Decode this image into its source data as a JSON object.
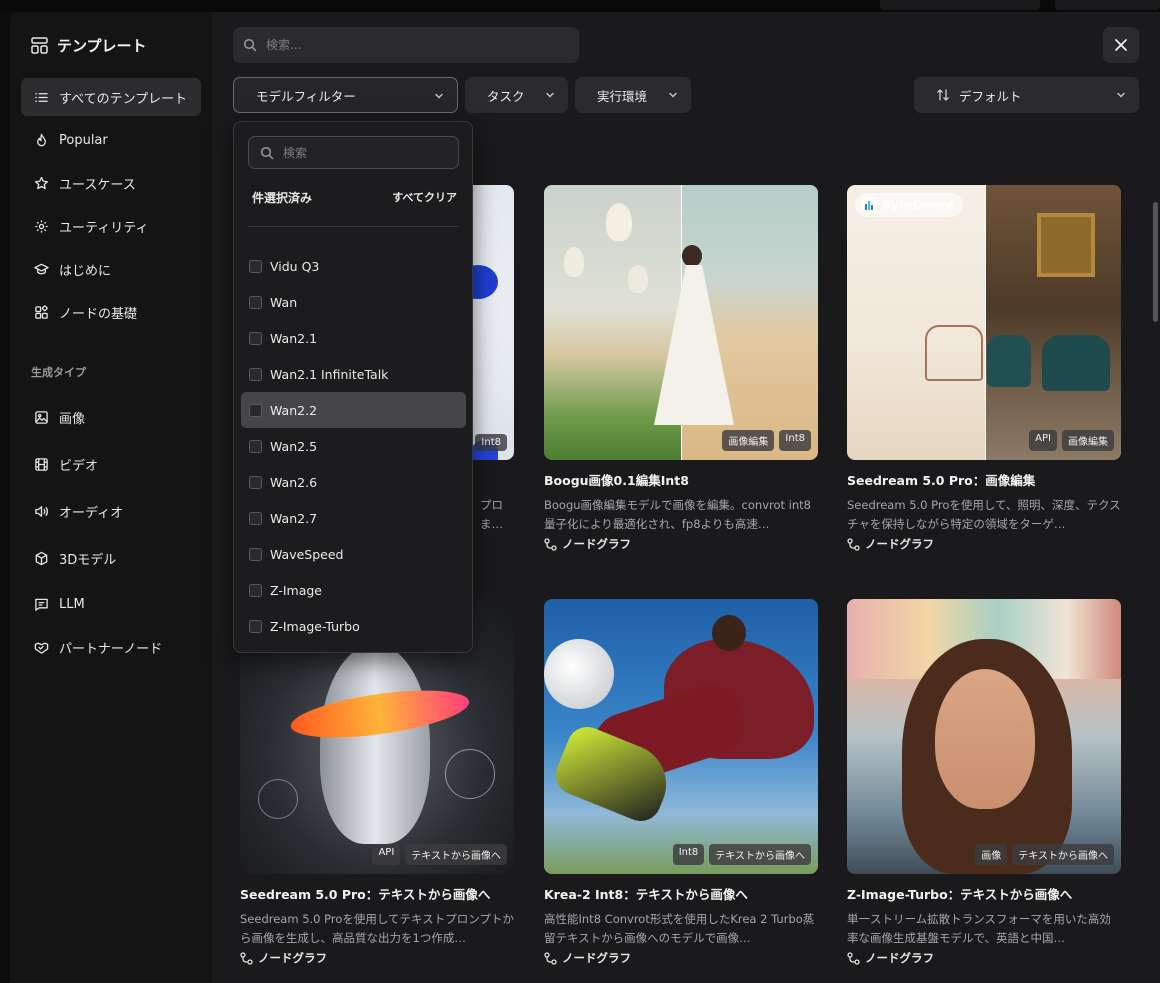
{
  "sidebar": {
    "title": "テンプレート",
    "items": [
      {
        "label": "すべてのテンプレート",
        "icon": "list-icon",
        "active": true
      },
      {
        "label": "Popular",
        "icon": "flame-icon"
      },
      {
        "label": "ユースケース",
        "icon": "star-icon"
      },
      {
        "label": "ユーティリティ",
        "icon": "gear-icon"
      },
      {
        "label": "はじめに",
        "icon": "graduation-cap-icon"
      },
      {
        "label": "ノードの基礎",
        "icon": "blocks-icon"
      }
    ],
    "section_label": "生成タイプ",
    "gen_items": [
      {
        "label": "画像",
        "icon": "image-icon"
      },
      {
        "label": "ビデオ",
        "icon": "film-icon"
      },
      {
        "label": "オーディオ",
        "icon": "speaker-icon"
      },
      {
        "label": "3Dモデル",
        "icon": "cube-icon"
      },
      {
        "label": "LLM",
        "icon": "message-icon"
      },
      {
        "label": "パートナーノード",
        "icon": "handshake-icon"
      }
    ]
  },
  "search": {
    "placeholder": "検索..."
  },
  "filters": {
    "model": "モデルフィルター",
    "task": "タスク",
    "env": "実行環境",
    "sort": "デフォルト"
  },
  "dropdown": {
    "search_placeholder": "検索",
    "selected_label": "件選択済み",
    "clear_label": "すべてクリア",
    "options": [
      "Vidu Q3",
      "Wan",
      "Wan2.1",
      "Wan2.1 InfiniteTalk",
      "Wan2.2",
      "Wan2.5",
      "Wan2.6",
      "Wan2.7",
      "WaveSpeed",
      "Z-Image",
      "Z-Image-Turbo"
    ],
    "hovered": "Wan2.2"
  },
  "cards": [
    {
      "title": "",
      "desc": "プロ\nます。...",
      "badges": [
        "Int8"
      ],
      "meta": ""
    },
    {
      "title": "Boogu画像0.1編集Int8",
      "desc": "Boogu画像編集モデルで画像を編集。convrot int8量子化により最適化され、fp8よりも高速…",
      "badges": [
        "画像編集",
        "Int8"
      ],
      "meta": "ノードグラフ"
    },
    {
      "title": "Seedream 5.0 Pro：画像編集",
      "desc": "Seedream 5.0 Proを使用して、照明、深度、テクスチャを保持しながら特定の領域をターゲ…",
      "badges": [
        "API",
        "画像編集"
      ],
      "meta": "ノードグラフ",
      "brand": "ByteDance"
    },
    {
      "title": "Seedream 5.0 Pro：テキストから画像へ",
      "desc": "Seedream 5.0 Proを使用してテキストプロンプトから画像を生成し、高品質な出力を1つ作成…",
      "badges": [
        "API",
        "テキストから画像へ"
      ],
      "meta": "ノードグラフ"
    },
    {
      "title": "Krea-2 Int8：テキストから画像へ",
      "desc": "高性能Int8 Convrot形式を使用したKrea 2 Turbo蒸留テキストから画像へのモデルで画像…",
      "badges": [
        "Int8",
        "テキストから画像へ"
      ],
      "meta": "ノードグラフ"
    },
    {
      "title": "Z-Image-Turbo：テキストから画像へ",
      "desc": "単一ストリーム拡散トランスフォーマを用いた高効率な画像生成基盤モデルで、英語と中国…",
      "badges": [
        "画像",
        "テキストから画像へ"
      ],
      "meta": "ノードグラフ"
    }
  ]
}
